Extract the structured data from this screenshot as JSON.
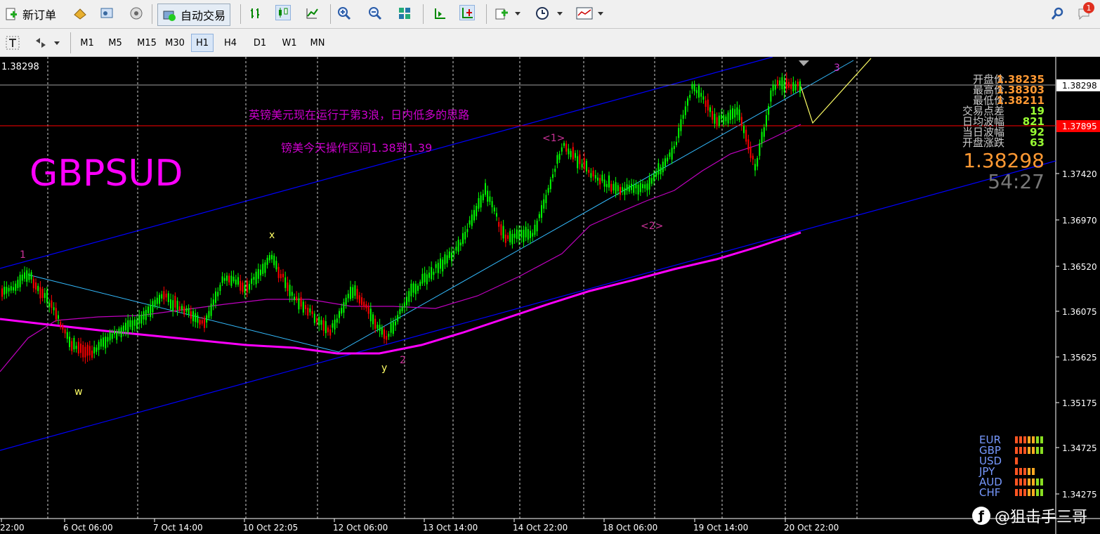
{
  "toolbar": {
    "new_order": "新订单",
    "auto_trading": "自动交易",
    "timeframes": [
      "M1",
      "M5",
      "M15",
      "M30",
      "H1",
      "H4",
      "D1",
      "W1",
      "MN"
    ],
    "active_timeframe": "H1",
    "notification_count": "1"
  },
  "chart": {
    "current_price_top": "1.38298",
    "symbol_label": "GBPSUD",
    "annotation_1": "英镑美元现在运行于第3浪，日内低多的思路",
    "annotation_2": "镑美今天操作区间1.38到1.39",
    "wave_labels": [
      "1",
      "x",
      "w",
      "y",
      "2",
      "<1>",
      "<2>",
      "3"
    ],
    "price_axis": [
      "1.38298",
      "1.37895",
      "1.37420",
      "1.36970",
      "1.36520",
      "1.36075",
      "1.35625",
      "1.35175",
      "1.34725",
      "1.34275"
    ],
    "time_axis": [
      "22:00",
      "6 Oct 06:00",
      "7 Oct 14:00",
      "10 Oct 22:05",
      "12 Oct 06:00",
      "13 Oct 14:00",
      "14 Oct 22:00",
      "18 Oct 06:00",
      "19 Oct 14:00",
      "20 Oct 22:00"
    ],
    "info_panel": [
      {
        "label": "开盘价",
        "value": "1.38235"
      },
      {
        "label": "最高价",
        "value": "1.38303"
      },
      {
        "label": "最低价",
        "value": "1.38211"
      },
      {
        "label": "交易点差",
        "value": "19"
      },
      {
        "label": "日均波幅",
        "value": "821"
      },
      {
        "label": "当日波幅",
        "value": "92"
      },
      {
        "label": "开盘涨跌",
        "value": "63"
      }
    ],
    "big_price": "1.38298",
    "countdown": "54:27",
    "currencies": [
      "EUR",
      "GBP",
      "USD",
      "JPY",
      "AUD",
      "CHF"
    ],
    "currency_strength": [
      7,
      7,
      1,
      5,
      7,
      7
    ],
    "colors": {
      "bull": "#00ff00",
      "bear": "#ff0000",
      "magenta": "#ff00ff",
      "channel": "#0000ff",
      "trend": "#00ccff"
    }
  },
  "watermark": "@狙击手三哥"
}
